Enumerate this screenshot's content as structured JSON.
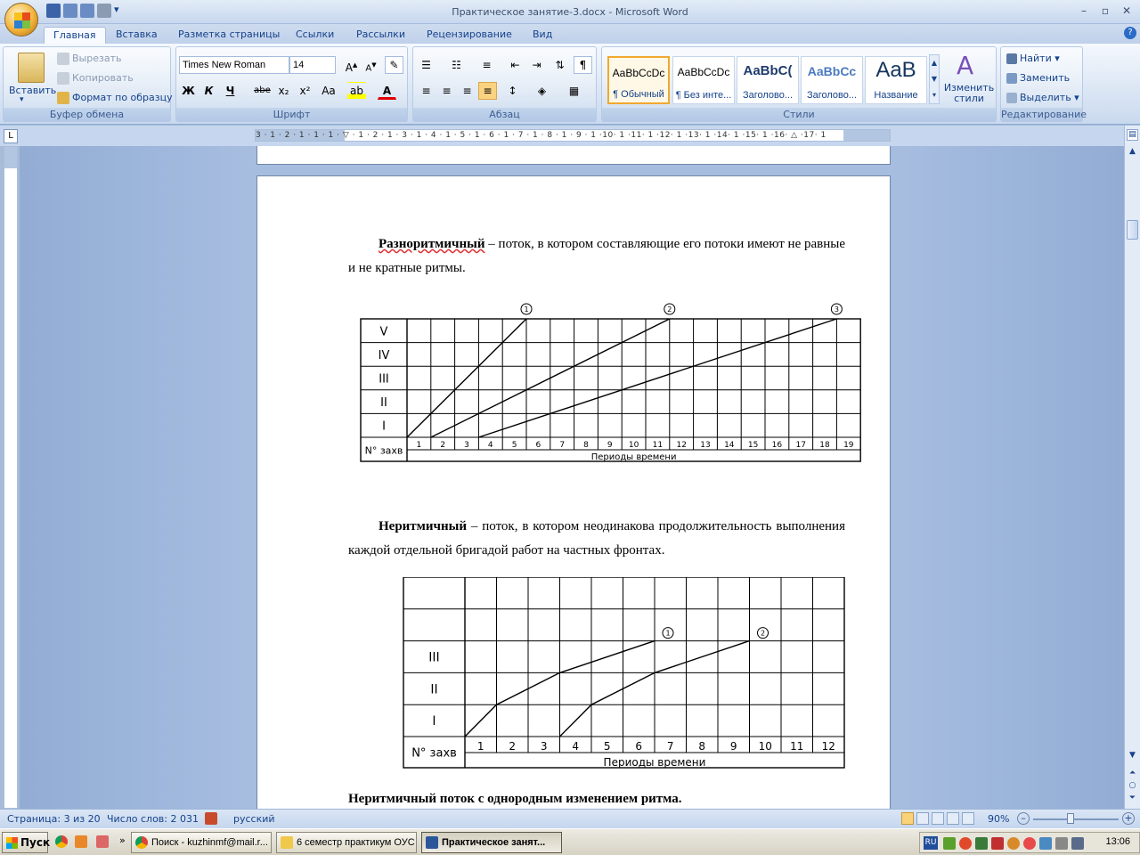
{
  "window": {
    "title": "Практическое занятие-3.docx - Microsoft Word"
  },
  "tabs": [
    "Главная",
    "Вставка",
    "Разметка страницы",
    "Ссылки",
    "Рассылки",
    "Рецензирование",
    "Вид"
  ],
  "ribbon": {
    "clipboard": {
      "paste": "Вставить",
      "cut": "Вырезать",
      "copy": "Копировать",
      "format_painter": "Формат по образцу",
      "label": "Буфер обмена"
    },
    "font": {
      "name": "Times New Roman",
      "size": "14",
      "label": "Шрифт",
      "bold": "Ж",
      "italic": "К",
      "underline": "Ч",
      "strike": "abe",
      "subscript": "x₂",
      "superscript": "x²",
      "case": "Aa",
      "color": "A"
    },
    "paragraph": {
      "label": "Абзац"
    },
    "styles": {
      "label": "Стили",
      "change": "Изменить стили",
      "items": [
        {
          "sample": "AaBbCcDc",
          "name": "¶ Обычный"
        },
        {
          "sample": "AaBbCcDc",
          "name": "¶ Без инте..."
        },
        {
          "sample": "AaBbC(",
          "name": "Заголово..."
        },
        {
          "sample": "AaBbCc",
          "name": "Заголово..."
        },
        {
          "sample": "AaB",
          "name": "Название"
        }
      ]
    },
    "editing": {
      "label": "Редактирование",
      "find": "Найти",
      "replace": "Заменить",
      "select": "Выделить"
    }
  },
  "ruler": {
    "numbers": "3 · 1 · 2 · 1 · 1 · 1 · ▽ · 1 · 2 · 1 · 3 · 1 · 4 · 1 · 5 · 1 · 6 · 1 · 7 · 1 · 8 · 1 · 9 · 1 ·10· 1 ·11· 1 ·12· 1 ·13· 1 ·14· 1 ·15· 1 ·16· △ ·17· 1"
  },
  "document": {
    "p1_term": "Разноритмичный",
    "p1_rest": " – поток, в котором составляющие его потоки имеют не равные и не кратные ритмы.",
    "p2_term": "Неритмичный",
    "p2_rest": " – поток, в котором неодинакова продолжительность выполнения каждой отдельной бригадой работ на частных фронтах.",
    "p3": "Неритмичный поток с однородным изменением ритма."
  },
  "chart_data": [
    {
      "type": "line",
      "ylabels": [
        "V",
        "IV",
        "III",
        "II",
        "I"
      ],
      "row_header": "N° захв",
      "x": [
        1,
        2,
        3,
        4,
        5,
        6,
        7,
        8,
        9,
        10,
        11,
        12,
        13,
        14,
        15,
        16,
        17,
        18,
        19
      ],
      "xlabel": "Периоды времени",
      "series": [
        {
          "name": "1",
          "points": [
            [
              0,
              0
            ],
            [
              5,
              5
            ]
          ]
        },
        {
          "name": "2",
          "points": [
            [
              1,
              0
            ],
            [
              11,
              5
            ]
          ]
        },
        {
          "name": "3",
          "points": [
            [
              3,
              0
            ],
            [
              18,
              5
            ]
          ]
        }
      ]
    },
    {
      "type": "line",
      "ylabels": [
        "",
        "",
        "III",
        "II",
        "I"
      ],
      "row_header": "N° захв",
      "x": [
        1,
        2,
        3,
        4,
        5,
        6,
        7,
        8,
        9,
        10,
        11,
        12
      ],
      "xlabel": "Периоды времени",
      "series": [
        {
          "name": "1",
          "points": [
            [
              0,
              0
            ],
            [
              1,
              1
            ],
            [
              3,
              2
            ],
            [
              6,
              3
            ]
          ]
        },
        {
          "name": "2",
          "points": [
            [
              3,
              0
            ],
            [
              4,
              1
            ],
            [
              6,
              2
            ],
            [
              9,
              3
            ]
          ]
        }
      ]
    }
  ],
  "status": {
    "page": "Страница: 3 из 20",
    "words": "Число слов: 2 031",
    "lang": "русский",
    "zoom": "90%"
  },
  "taskbar": {
    "start": "Пуск",
    "items": [
      "Поиск - kuzhinmf@mail.r...",
      "6 семестр практикум ОУС",
      "Практическое занят..."
    ],
    "tray_lang": "RU",
    "clock": "13:06"
  }
}
